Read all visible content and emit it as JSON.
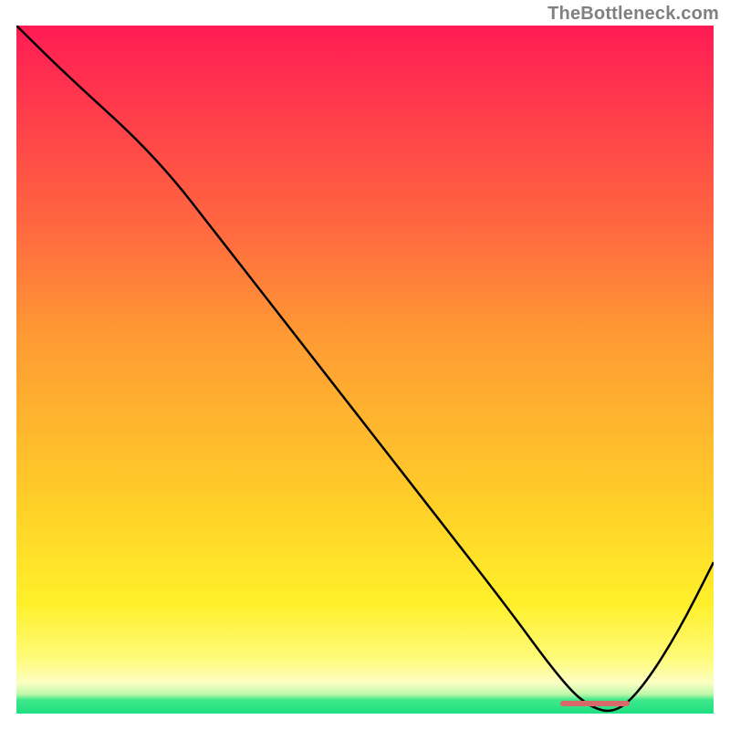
{
  "watermark": "TheBottleneck.com",
  "chart_data": {
    "type": "line",
    "title": "",
    "xlabel": "",
    "ylabel": "",
    "xlim": [
      0,
      100
    ],
    "ylim": [
      0,
      100
    ],
    "series": [
      {
        "name": "curve",
        "x": [
          0,
          7,
          20,
          30,
          40,
          50,
          60,
          70,
          78,
          82,
          86,
          90,
          95,
          100
        ],
        "values": [
          100,
          93,
          81,
          68,
          55,
          42,
          29,
          16,
          5,
          1,
          0,
          4,
          12,
          22
        ]
      }
    ],
    "optimal_band": {
      "x_start": 78,
      "x_end": 88,
      "y": 0
    },
    "background_gradient": {
      "stops": [
        {
          "pos": 0,
          "color": "#ff1b54"
        },
        {
          "pos": 45,
          "color": "#ff9a34"
        },
        {
          "pos": 84,
          "color": "#fff02a"
        },
        {
          "pos": 96,
          "color": "#fcffc2"
        },
        {
          "pos": 100,
          "color": "#1fe082"
        }
      ]
    }
  }
}
